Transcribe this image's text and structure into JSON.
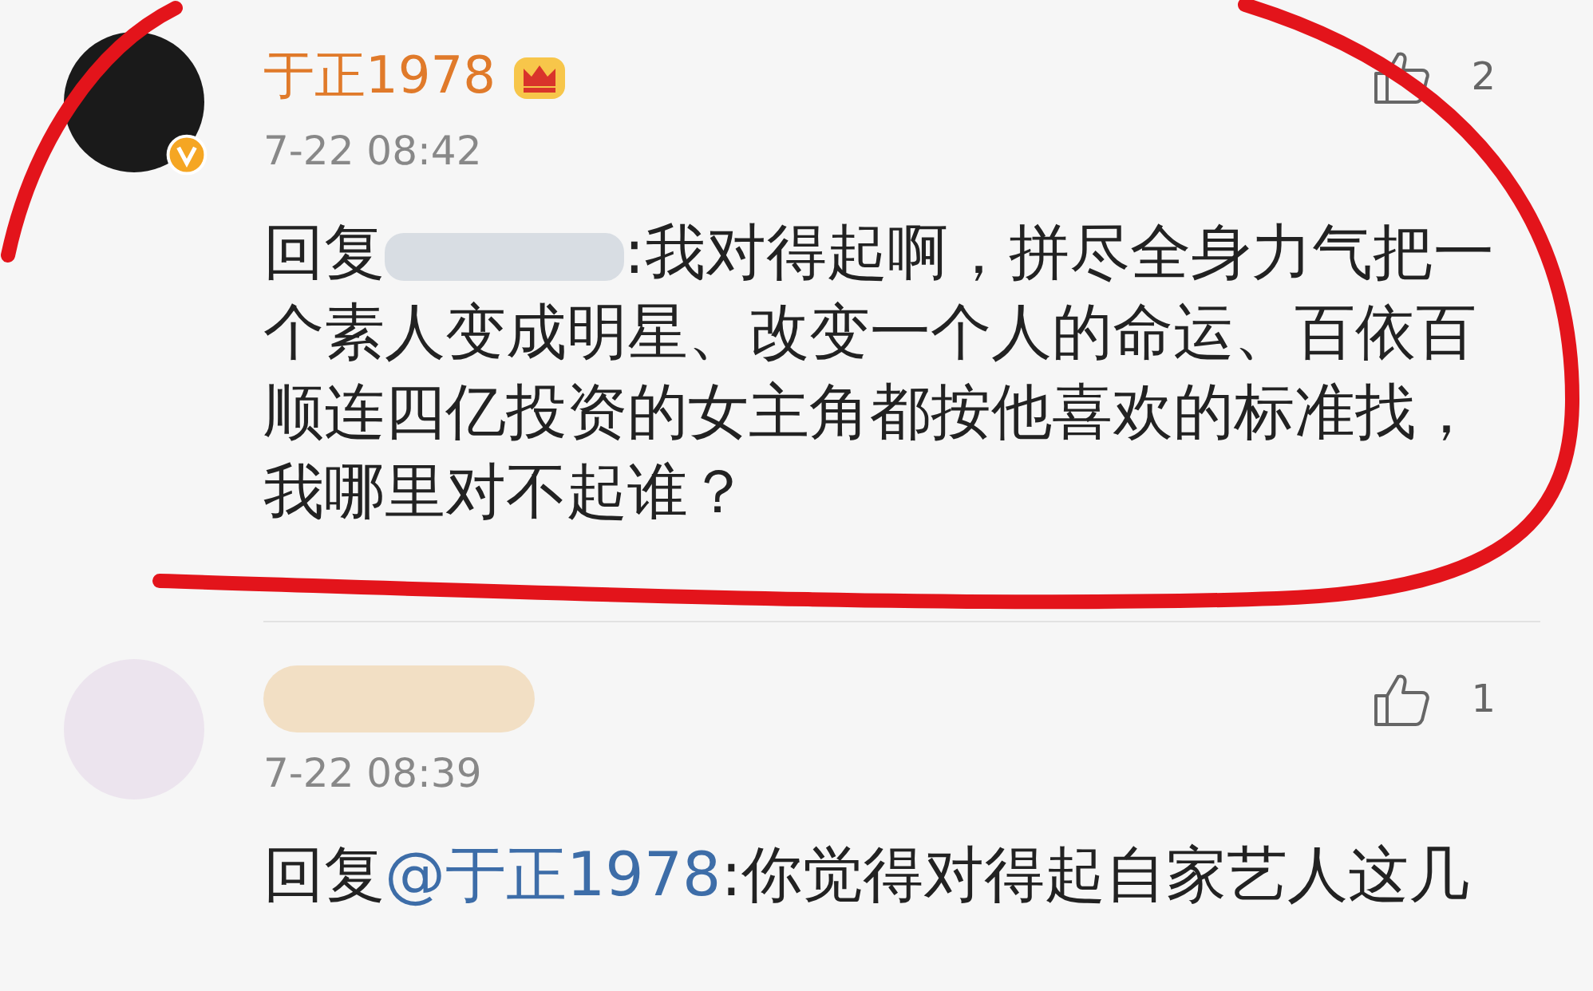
{
  "comments": [
    {
      "author": {
        "name": "于正1978",
        "name_hidden": false,
        "verified": true,
        "vip": true
      },
      "time": "7-22 08:42",
      "likes": "2",
      "reply": {
        "prefix": "回复",
        "mention_hidden": true,
        "text": ":我对得起啊，拼尽全身力气把一个素人变成明星、改变一个人的命运、百依百顺连四亿投资的女主角都按他喜欢的标准找，我哪里对不起谁？"
      }
    },
    {
      "author": {
        "name_hidden": true,
        "verified": false,
        "vip": false
      },
      "time": "7-22 08:39",
      "likes": "1",
      "reply": {
        "prefix": "回复",
        "mention": "@于正1978",
        "mention_hidden": false,
        "text": ":你觉得对得起自家艺人这几"
      }
    }
  ]
}
